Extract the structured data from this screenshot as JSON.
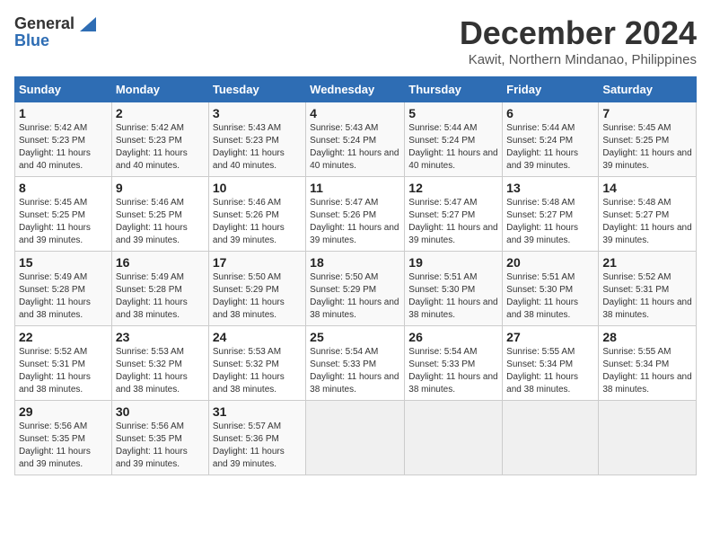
{
  "logo": {
    "line1a": "General",
    "line1b": "Blue",
    "line2": "Blue"
  },
  "title": "December 2024",
  "subtitle": "Kawit, Northern Mindanao, Philippines",
  "days_header": [
    "Sunday",
    "Monday",
    "Tuesday",
    "Wednesday",
    "Thursday",
    "Friday",
    "Saturday"
  ],
  "weeks": [
    [
      {
        "day": "1",
        "sunrise": "Sunrise: 5:42 AM",
        "sunset": "Sunset: 5:23 PM",
        "daylight": "Daylight: 11 hours and 40 minutes."
      },
      {
        "day": "2",
        "sunrise": "Sunrise: 5:42 AM",
        "sunset": "Sunset: 5:23 PM",
        "daylight": "Daylight: 11 hours and 40 minutes."
      },
      {
        "day": "3",
        "sunrise": "Sunrise: 5:43 AM",
        "sunset": "Sunset: 5:23 PM",
        "daylight": "Daylight: 11 hours and 40 minutes."
      },
      {
        "day": "4",
        "sunrise": "Sunrise: 5:43 AM",
        "sunset": "Sunset: 5:24 PM",
        "daylight": "Daylight: 11 hours and 40 minutes."
      },
      {
        "day": "5",
        "sunrise": "Sunrise: 5:44 AM",
        "sunset": "Sunset: 5:24 PM",
        "daylight": "Daylight: 11 hours and 40 minutes."
      },
      {
        "day": "6",
        "sunrise": "Sunrise: 5:44 AM",
        "sunset": "Sunset: 5:24 PM",
        "daylight": "Daylight: 11 hours and 39 minutes."
      },
      {
        "day": "7",
        "sunrise": "Sunrise: 5:45 AM",
        "sunset": "Sunset: 5:25 PM",
        "daylight": "Daylight: 11 hours and 39 minutes."
      }
    ],
    [
      {
        "day": "8",
        "sunrise": "Sunrise: 5:45 AM",
        "sunset": "Sunset: 5:25 PM",
        "daylight": "Daylight: 11 hours and 39 minutes."
      },
      {
        "day": "9",
        "sunrise": "Sunrise: 5:46 AM",
        "sunset": "Sunset: 5:25 PM",
        "daylight": "Daylight: 11 hours and 39 minutes."
      },
      {
        "day": "10",
        "sunrise": "Sunrise: 5:46 AM",
        "sunset": "Sunset: 5:26 PM",
        "daylight": "Daylight: 11 hours and 39 minutes."
      },
      {
        "day": "11",
        "sunrise": "Sunrise: 5:47 AM",
        "sunset": "Sunset: 5:26 PM",
        "daylight": "Daylight: 11 hours and 39 minutes."
      },
      {
        "day": "12",
        "sunrise": "Sunrise: 5:47 AM",
        "sunset": "Sunset: 5:27 PM",
        "daylight": "Daylight: 11 hours and 39 minutes."
      },
      {
        "day": "13",
        "sunrise": "Sunrise: 5:48 AM",
        "sunset": "Sunset: 5:27 PM",
        "daylight": "Daylight: 11 hours and 39 minutes."
      },
      {
        "day": "14",
        "sunrise": "Sunrise: 5:48 AM",
        "sunset": "Sunset: 5:27 PM",
        "daylight": "Daylight: 11 hours and 39 minutes."
      }
    ],
    [
      {
        "day": "15",
        "sunrise": "Sunrise: 5:49 AM",
        "sunset": "Sunset: 5:28 PM",
        "daylight": "Daylight: 11 hours and 38 minutes."
      },
      {
        "day": "16",
        "sunrise": "Sunrise: 5:49 AM",
        "sunset": "Sunset: 5:28 PM",
        "daylight": "Daylight: 11 hours and 38 minutes."
      },
      {
        "day": "17",
        "sunrise": "Sunrise: 5:50 AM",
        "sunset": "Sunset: 5:29 PM",
        "daylight": "Daylight: 11 hours and 38 minutes."
      },
      {
        "day": "18",
        "sunrise": "Sunrise: 5:50 AM",
        "sunset": "Sunset: 5:29 PM",
        "daylight": "Daylight: 11 hours and 38 minutes."
      },
      {
        "day": "19",
        "sunrise": "Sunrise: 5:51 AM",
        "sunset": "Sunset: 5:30 PM",
        "daylight": "Daylight: 11 hours and 38 minutes."
      },
      {
        "day": "20",
        "sunrise": "Sunrise: 5:51 AM",
        "sunset": "Sunset: 5:30 PM",
        "daylight": "Daylight: 11 hours and 38 minutes."
      },
      {
        "day": "21",
        "sunrise": "Sunrise: 5:52 AM",
        "sunset": "Sunset: 5:31 PM",
        "daylight": "Daylight: 11 hours and 38 minutes."
      }
    ],
    [
      {
        "day": "22",
        "sunrise": "Sunrise: 5:52 AM",
        "sunset": "Sunset: 5:31 PM",
        "daylight": "Daylight: 11 hours and 38 minutes."
      },
      {
        "day": "23",
        "sunrise": "Sunrise: 5:53 AM",
        "sunset": "Sunset: 5:32 PM",
        "daylight": "Daylight: 11 hours and 38 minutes."
      },
      {
        "day": "24",
        "sunrise": "Sunrise: 5:53 AM",
        "sunset": "Sunset: 5:32 PM",
        "daylight": "Daylight: 11 hours and 38 minutes."
      },
      {
        "day": "25",
        "sunrise": "Sunrise: 5:54 AM",
        "sunset": "Sunset: 5:33 PM",
        "daylight": "Daylight: 11 hours and 38 minutes."
      },
      {
        "day": "26",
        "sunrise": "Sunrise: 5:54 AM",
        "sunset": "Sunset: 5:33 PM",
        "daylight": "Daylight: 11 hours and 38 minutes."
      },
      {
        "day": "27",
        "sunrise": "Sunrise: 5:55 AM",
        "sunset": "Sunset: 5:34 PM",
        "daylight": "Daylight: 11 hours and 38 minutes."
      },
      {
        "day": "28",
        "sunrise": "Sunrise: 5:55 AM",
        "sunset": "Sunset: 5:34 PM",
        "daylight": "Daylight: 11 hours and 38 minutes."
      }
    ],
    [
      {
        "day": "29",
        "sunrise": "Sunrise: 5:56 AM",
        "sunset": "Sunset: 5:35 PM",
        "daylight": "Daylight: 11 hours and 39 minutes."
      },
      {
        "day": "30",
        "sunrise": "Sunrise: 5:56 AM",
        "sunset": "Sunset: 5:35 PM",
        "daylight": "Daylight: 11 hours and 39 minutes."
      },
      {
        "day": "31",
        "sunrise": "Sunrise: 5:57 AM",
        "sunset": "Sunset: 5:36 PM",
        "daylight": "Daylight: 11 hours and 39 minutes."
      },
      null,
      null,
      null,
      null
    ]
  ]
}
